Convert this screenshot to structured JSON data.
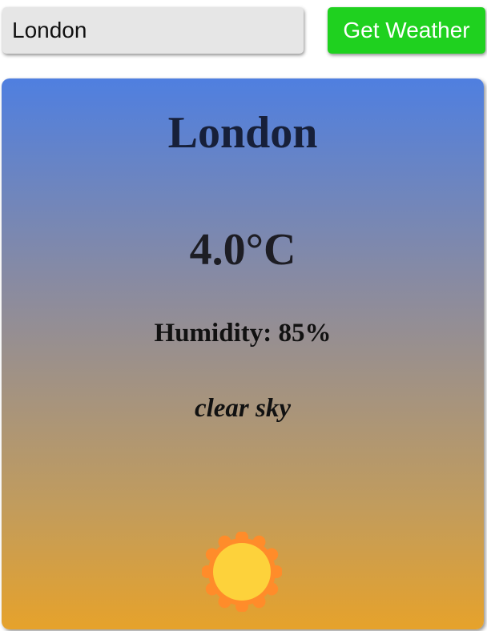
{
  "search": {
    "value": "London",
    "button_label": "Get Weather"
  },
  "weather": {
    "city": "London",
    "temperature": "4.0°C",
    "humidity": "Humidity: 85%",
    "description": "clear sky",
    "icon": "sun-icon"
  },
  "colors": {
    "button_bg": "#1fd11f",
    "input_bg": "#e6e6e6",
    "card_gradient_top": "#4f7fe0",
    "card_gradient_bottom": "#e6a22b",
    "sun_outer": "#ff8c2a",
    "sun_inner": "#fdd23b"
  }
}
